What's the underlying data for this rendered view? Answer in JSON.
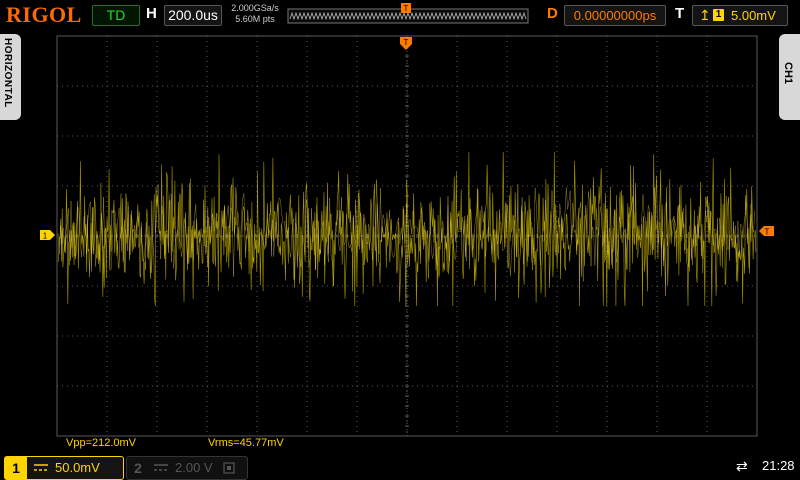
{
  "header": {
    "brand": "RIGOL",
    "run_status": "TD",
    "horizontal_label": "H",
    "timebase": "200.0us",
    "sample_rate": "2.000GSa/s",
    "memory_depth": "5.60M pts",
    "trigger_marker": "T",
    "delay_label": "D",
    "delay_value": "0.00000000ps",
    "trigger_label": "T",
    "trigger_channel": "1",
    "trigger_level": "5.00mV"
  },
  "side_tabs": {
    "left": "HORIZONTAL",
    "right": "CH1"
  },
  "markers": {
    "channel1_ground": "1",
    "trigger_level": "T",
    "trigger_position": "T"
  },
  "measurements": {
    "vpp": "Vpp=212.0mV",
    "vrms": "Vrms=45.77mV"
  },
  "channels": [
    {
      "number": "1",
      "scale": "50.0mV",
      "active": true
    },
    {
      "number": "2",
      "scale": "2.00 V",
      "active": false
    }
  ],
  "statusbar": {
    "usb_icon": "usb-icon",
    "time": "21:28"
  },
  "colors": {
    "trace": "#ffd400",
    "trigger": "#ff7a00",
    "grid": "#4a4a4a",
    "brand": "#ff6a00"
  }
}
